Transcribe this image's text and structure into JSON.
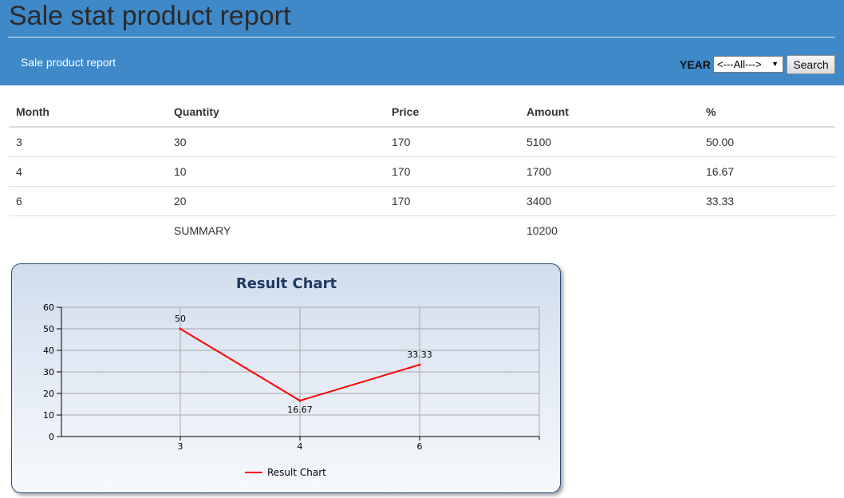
{
  "header": {
    "title": "Sale stat product report",
    "subtitle": "Sale product report",
    "year_label": "YEAR",
    "year_selected": "<---All--->",
    "search_label": "Search"
  },
  "table": {
    "headers": [
      "Month",
      "Quantity",
      "Price",
      "Amount",
      "%"
    ],
    "rows": [
      [
        "3",
        "30",
        "170",
        "5100",
        "50.00"
      ],
      [
        "4",
        "10",
        "170",
        "1700",
        "16.67"
      ],
      [
        "6",
        "20",
        "170",
        "3400",
        "33.33"
      ]
    ],
    "summary": [
      "",
      "SUMMARY",
      "",
      "10200",
      ""
    ]
  },
  "chart_data": {
    "type": "line",
    "title": "Result Chart",
    "categories": [
      "3",
      "4",
      "6"
    ],
    "series": [
      {
        "name": "Result Chart",
        "values": [
          50,
          16.67,
          33.33
        ],
        "labels": [
          "50",
          "16.67",
          "33.33"
        ],
        "color": "#ff0000"
      }
    ],
    "ylim": [
      0,
      60
    ],
    "yticks": [
      "0",
      "10",
      "20",
      "30",
      "40",
      "50",
      "60"
    ],
    "grid": true,
    "legend": "bottom-center"
  }
}
